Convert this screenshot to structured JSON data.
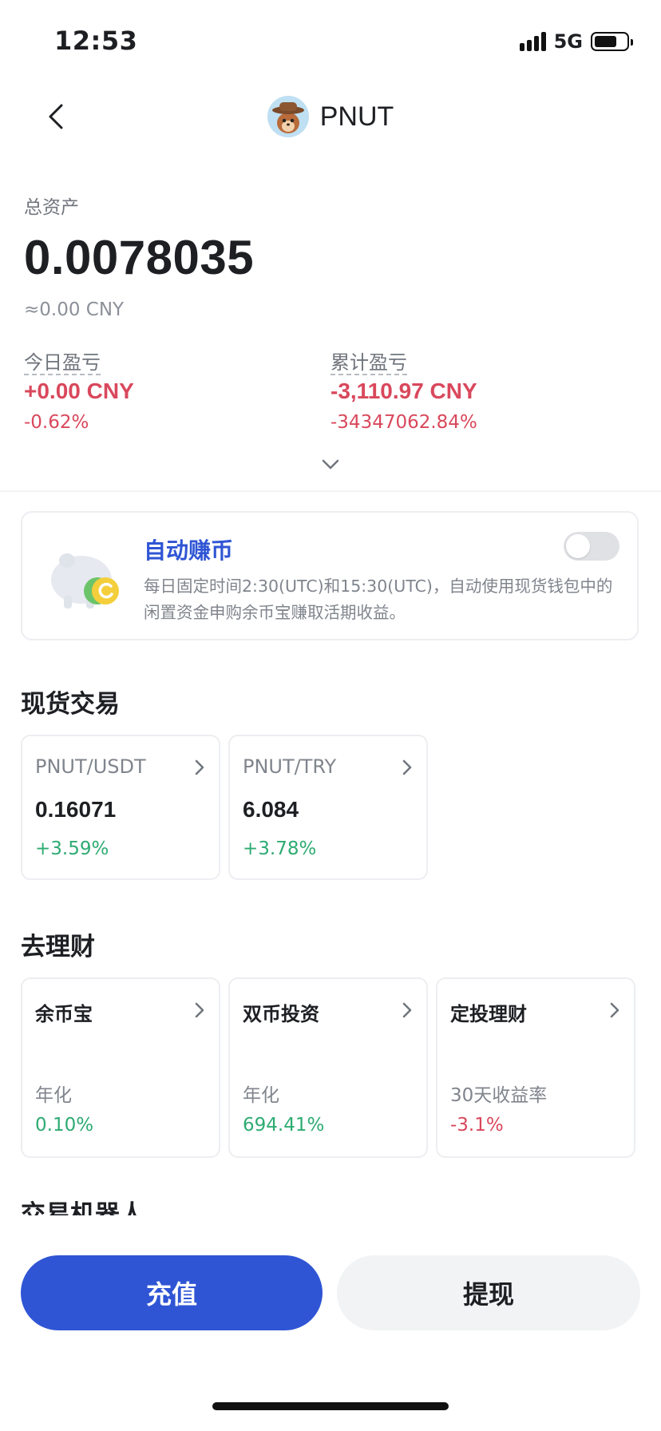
{
  "status_bar": {
    "time": "12:53",
    "network": "5G"
  },
  "header": {
    "title": "PNUT",
    "avatar_icon": "pnut-squirrel-cowboy-icon"
  },
  "asset": {
    "label": "总资产",
    "value": "0.0078035",
    "cny": "≈0.00 CNY"
  },
  "pnl": {
    "today": {
      "label": "今日盈亏",
      "amount": "+0.00 CNY",
      "percent": "-0.62%"
    },
    "total": {
      "label": "累计盈亏",
      "amount": "-3,110.97 CNY",
      "percent": "-34347062.84%"
    }
  },
  "auto_earn": {
    "title": "自动赚币",
    "description": "每日固定时间2:30(UTC)和15:30(UTC)，自动使用现货钱包中的闲置资金申购余币宝赚取活期收益。",
    "enabled": false
  },
  "spot": {
    "title": "现货交易",
    "pairs": [
      {
        "pair": "PNUT/USDT",
        "price": "0.16071",
        "change": "+3.59%"
      },
      {
        "pair": "PNUT/TRY",
        "price": "6.084",
        "change": "+3.78%"
      }
    ]
  },
  "finance": {
    "title": "去理财",
    "products": [
      {
        "name": "余币宝",
        "metric": "年化",
        "rate": "0.10%"
      },
      {
        "name": "双币投资",
        "metric": "年化",
        "rate": "694.41%"
      },
      {
        "name": "定投理财",
        "metric": "30天收益率",
        "rate": "-3.1%"
      }
    ]
  },
  "next_section": {
    "title": "交易机器人"
  },
  "actions": {
    "deposit": "充值",
    "withdraw": "提现"
  },
  "colors": {
    "accent": "#2f55d4",
    "loss": "#d9485c",
    "gain": "#2eab72"
  }
}
